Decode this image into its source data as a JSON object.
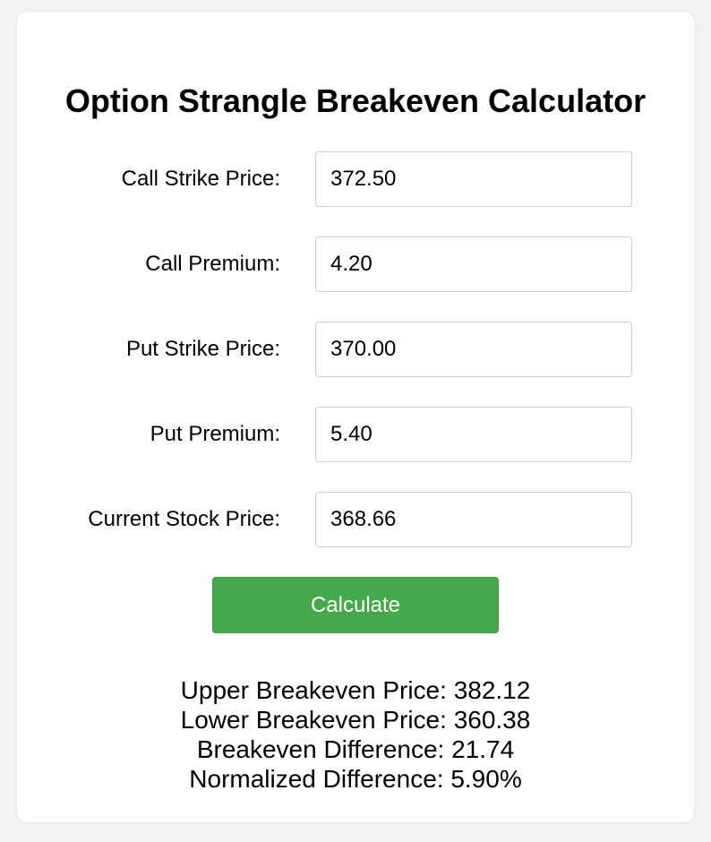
{
  "title": "Option Strangle Breakeven Calculator",
  "fields": [
    {
      "label": "Call Strike Price:",
      "value": "372.50"
    },
    {
      "label": "Call Premium:",
      "value": "4.20"
    },
    {
      "label": "Put Strike Price:",
      "value": "370.00"
    },
    {
      "label": "Put Premium:",
      "value": "5.40"
    },
    {
      "label": "Current Stock Price:",
      "value": "368.66"
    }
  ],
  "button": {
    "label": "Calculate"
  },
  "results": {
    "upper": "Upper Breakeven Price: 382.12",
    "lower": "Lower Breakeven Price: 360.38",
    "difference": "Breakeven Difference: 21.74",
    "normalized": "Normalized Difference: 5.90%"
  },
  "colors": {
    "button_bg": "#45a84b",
    "button_text": "#ffffff",
    "page_bg": "#f2f2f2",
    "card_bg": "#ffffff"
  }
}
